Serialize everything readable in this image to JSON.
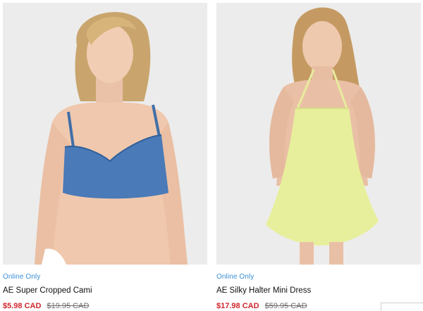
{
  "products": [
    {
      "badge": "Online Only",
      "name": "AE Super Cropped Cami",
      "sale_price": "$5.98 CAD",
      "original_price": "$19.95 CAD"
    },
    {
      "badge": "Online Only",
      "name": "AE Silky Halter Mini Dress",
      "sale_price": "$17.98 CAD",
      "original_price": "$59.95 CAD"
    }
  ],
  "colors": {
    "badge": "#3a8fd6",
    "sale": "#d0262d",
    "image_bg": "#ededed"
  }
}
